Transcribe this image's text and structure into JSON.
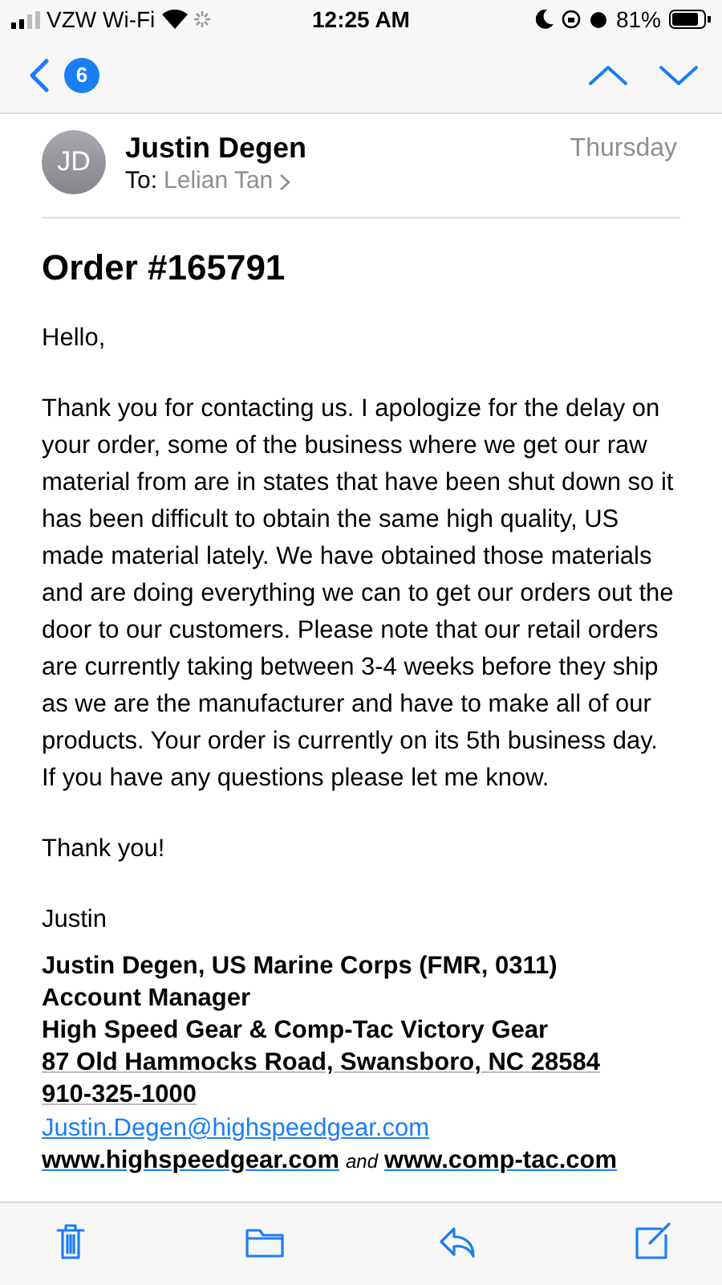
{
  "status_bar": {
    "carrier": "VZW Wi-Fi",
    "time": "12:25 AM",
    "battery": "81%"
  },
  "nav": {
    "unread_count": "6"
  },
  "message": {
    "initials": "JD",
    "sender": "Justin Degen",
    "to_label": "To:",
    "recipient": "Lelian Tan",
    "date": "Thursday"
  },
  "subject": "Order #165791",
  "body": [
    "Hello,",
    "Thank you for contacting us. I apologize for the delay on your order, some of the business where we get our raw material from are in states that have been shut down so it has been difficult to obtain the same high quality, US made material lately. We have obtained those materials and are doing everything we can to get our orders out the door to our customers. Please note that our retail orders are currently taking between 3-4 weeks before they ship as we are the manufacturer and have to make all of our products. Your order is currently on its 5th business day. If you have any questions please let me know.",
    "Thank you!",
    "Justin"
  ],
  "signature": [
    {
      "text": "Justin Degen, US Marine Corps (FMR, 0311)",
      "underlined": false
    },
    {
      "text": "Account Manager",
      "underlined": false
    },
    {
      "text": "High Speed Gear & Comp-Tac Victory Gear",
      "underlined": false
    },
    {
      "text": "87 Old Hammocks Road, Swansboro, NC 28584",
      "underlined": true
    },
    {
      "text": "910-325-1000",
      "underlined": true
    }
  ],
  "email_link": "Justin.Degen@highspeedgear.com",
  "websites": {
    "first": "www.highspeedgear.com",
    "connector": "and",
    "second": "www.comp-tac.com"
  }
}
